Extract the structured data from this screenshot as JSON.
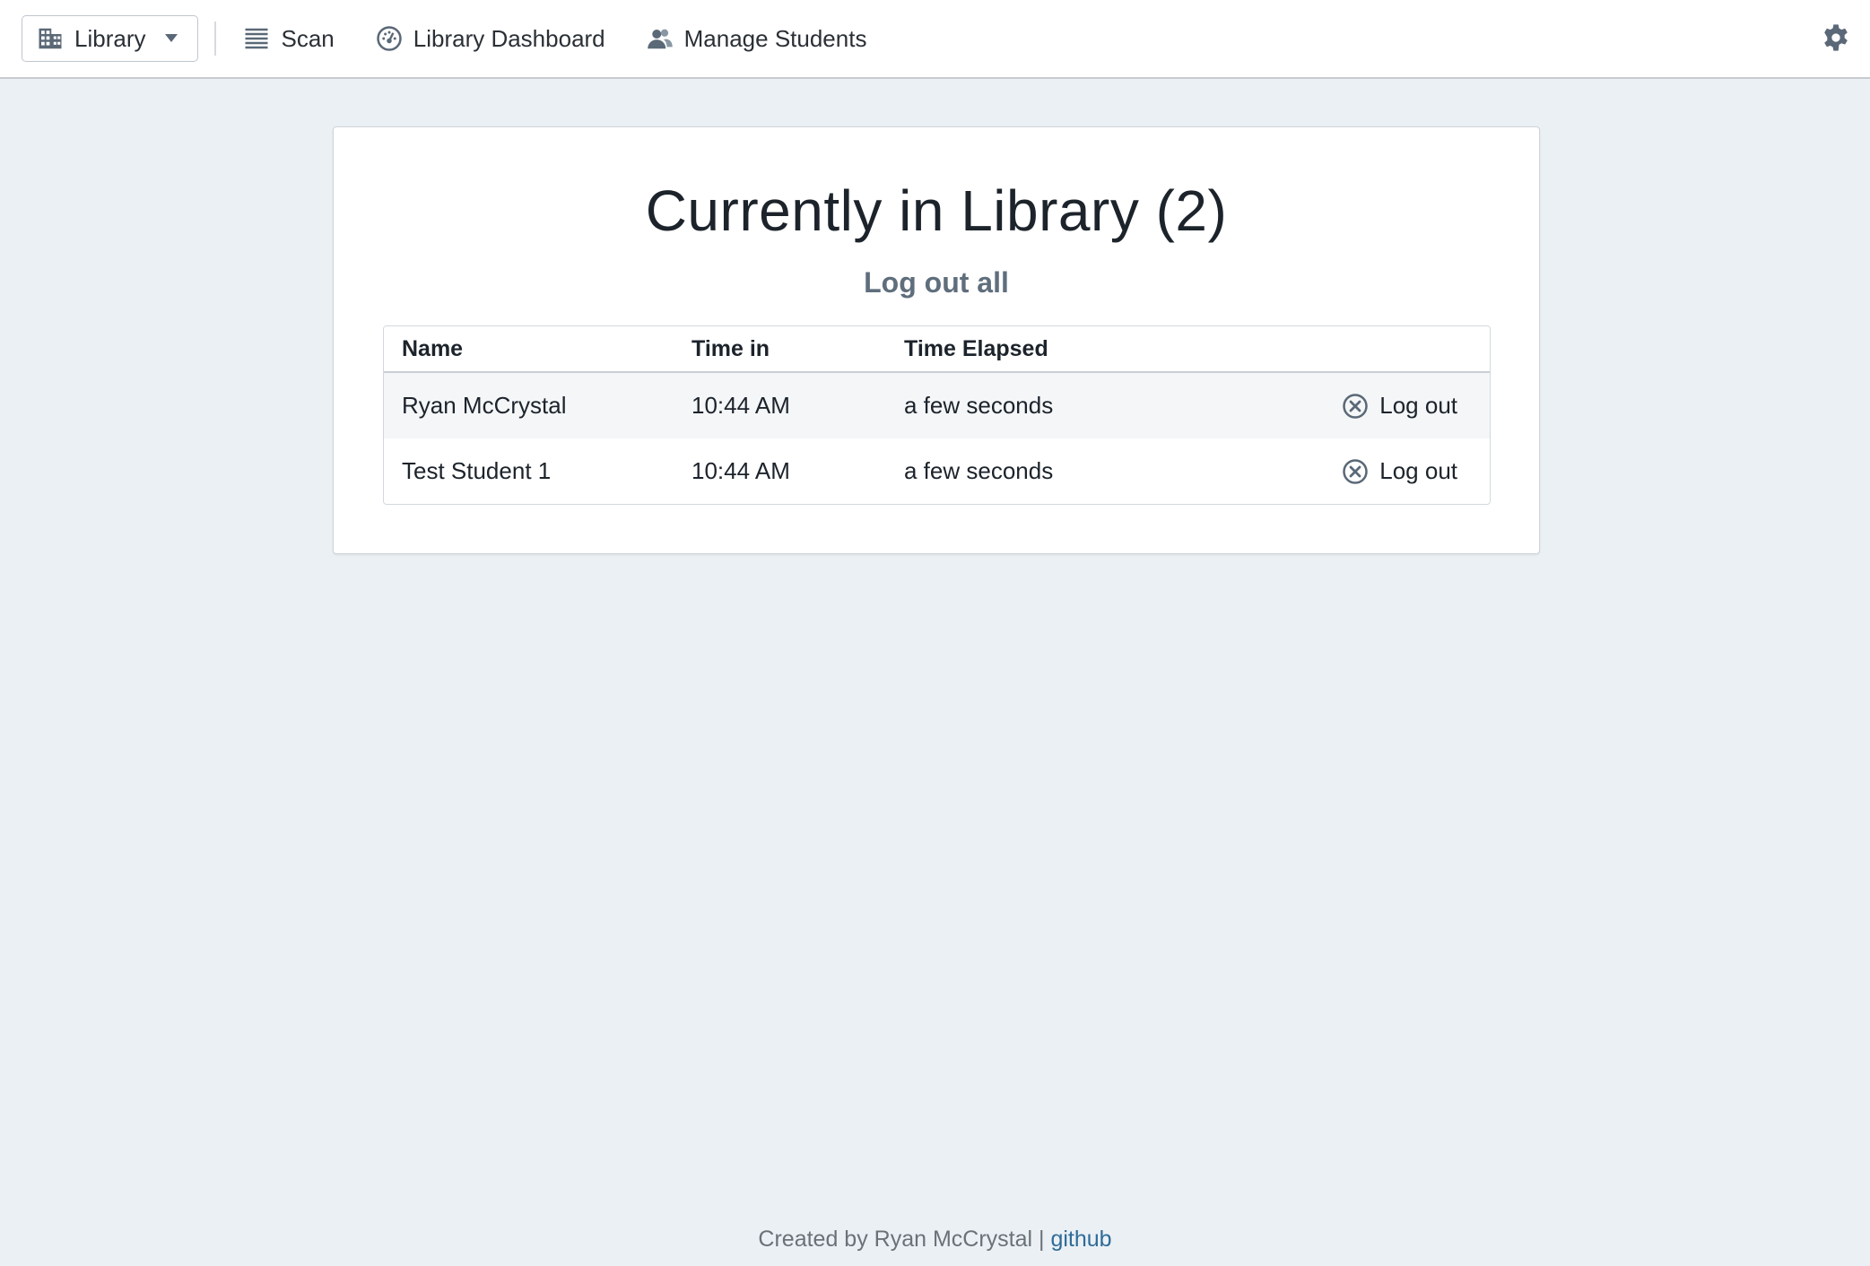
{
  "navbar": {
    "location_label": "Library",
    "items": [
      {
        "label": "Scan",
        "icon": "list-icon"
      },
      {
        "label": "Library Dashboard",
        "icon": "dashboard-icon"
      },
      {
        "label": "Manage Students",
        "icon": "users-icon"
      }
    ],
    "settings_icon": "gear-icon"
  },
  "card": {
    "title": "Currently in Library (2)",
    "logout_all_label": "Log out all",
    "table": {
      "headers": [
        "Name",
        "Time in",
        "Time Elapsed"
      ],
      "rows": [
        {
          "name": "Ryan McCrystal",
          "time_in": "10:44 AM",
          "elapsed": "a few seconds",
          "action": "Log out"
        },
        {
          "name": "Test Student 1",
          "time_in": "10:44 AM",
          "elapsed": "a few seconds",
          "action": "Log out"
        }
      ]
    }
  },
  "footer": {
    "text": "Created by Ryan McCrystal |",
    "link_label": "github"
  },
  "colors": {
    "background": "#ebf0f4",
    "icon": "#5a6877",
    "link": "#2e6b99"
  }
}
